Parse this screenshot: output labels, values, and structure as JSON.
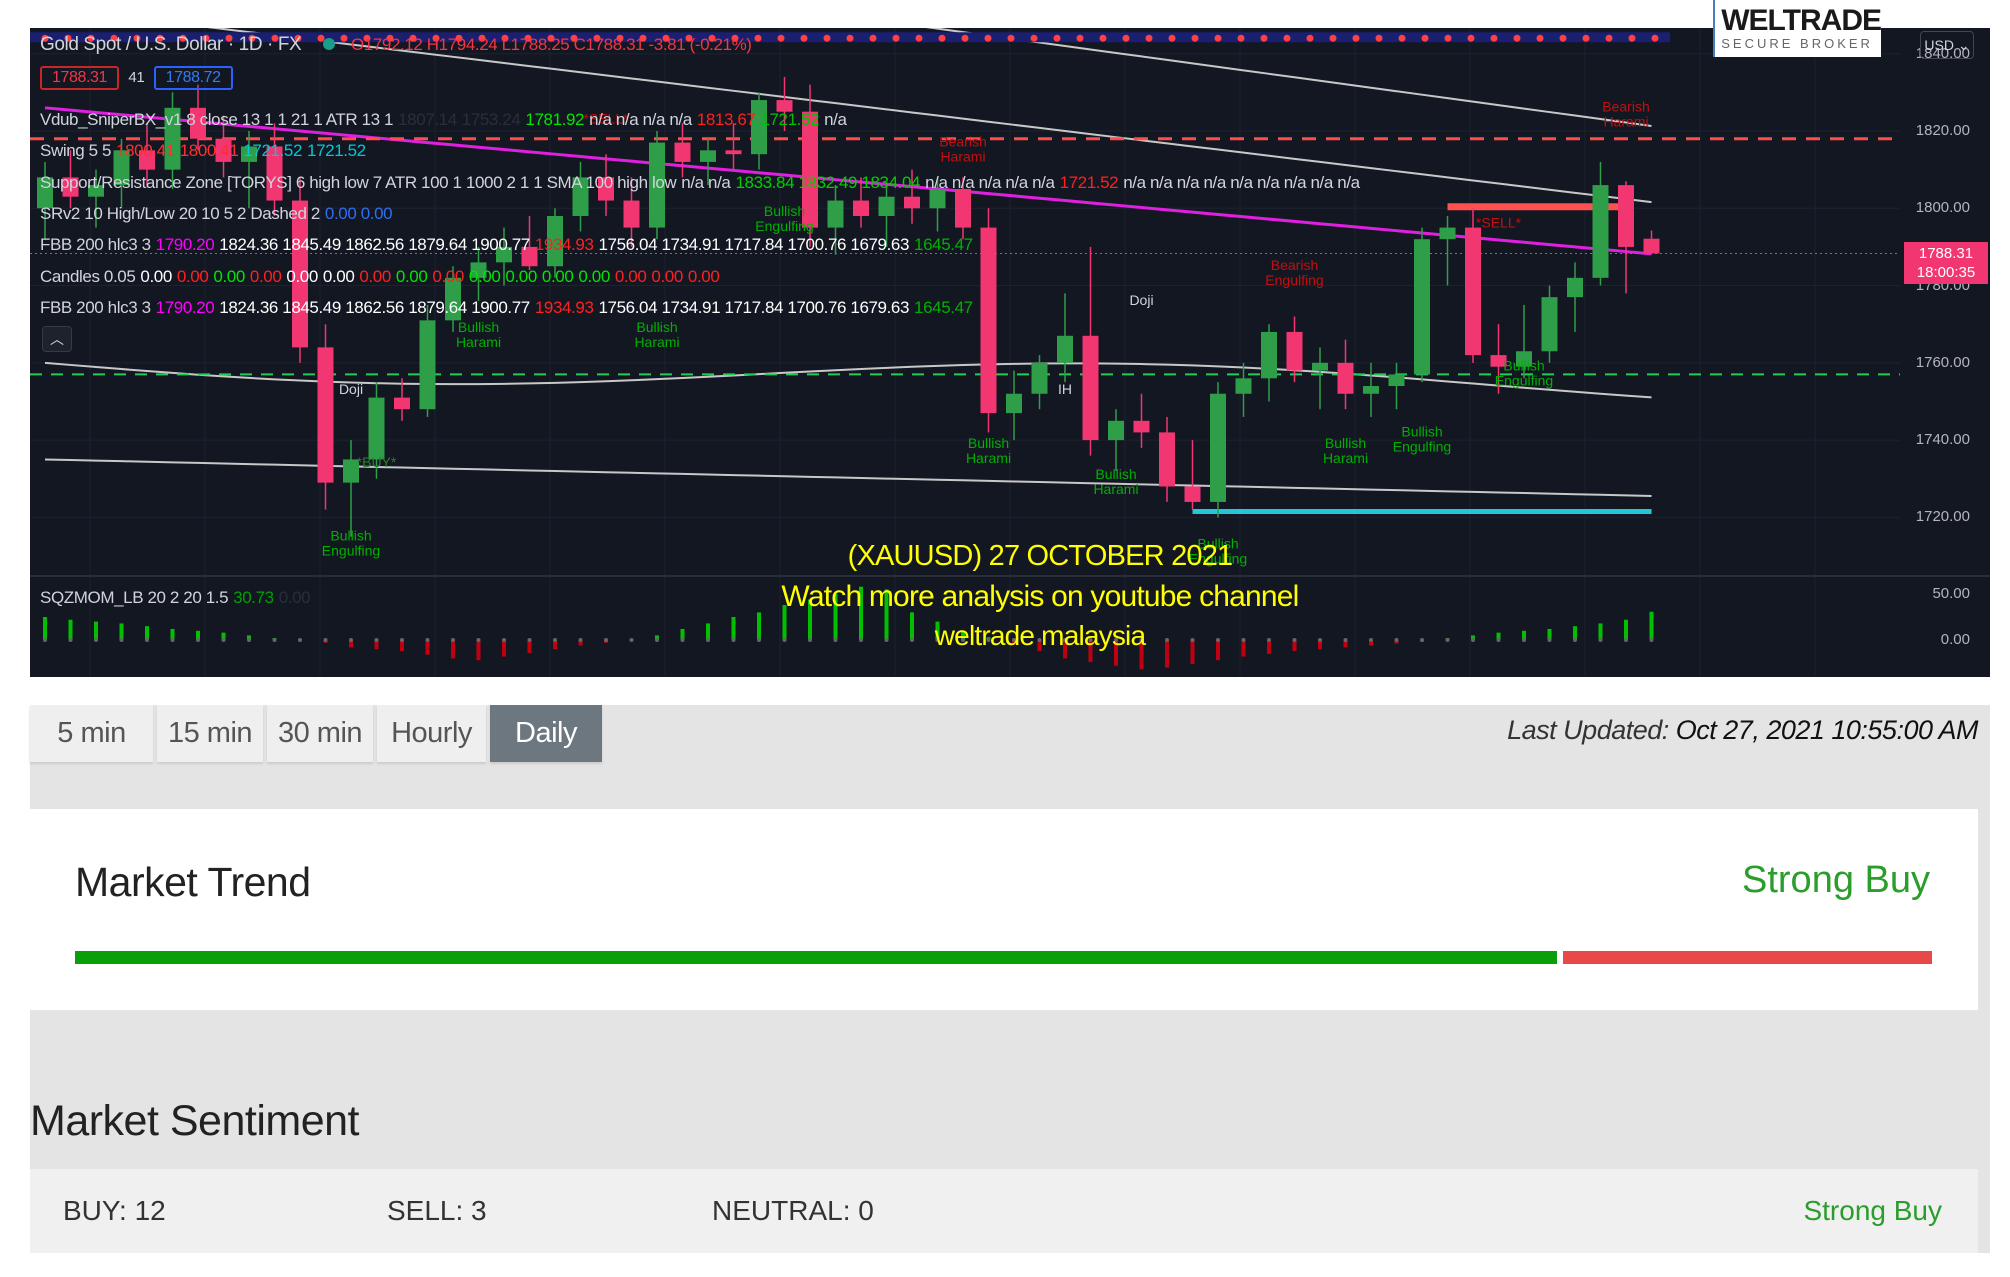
{
  "chart": {
    "symbol_line": "Gold Spot / U.S. Dollar · 1D · FX",
    "ohlc": "O1792.12 H1794.24 L1788.25 C1788.31 -3.81 (-0.21%)",
    "bid": "1788.31",
    "spread": "41",
    "ask": "1788.72",
    "currency": "USD",
    "last_price": "1788.31",
    "countdown": "18:00:35",
    "price_axis": [
      "1840.00",
      "1820.00",
      "1800.00",
      "1780.00",
      "1760.00",
      "1740.00",
      "1720.00"
    ],
    "momentum_axis": [
      "50.00",
      "0.00"
    ],
    "indicators": [
      [
        {
          "t": "Vdub_SniperBX_v1 8 close 13 1 1 21 1 ATR 13 1",
          "c": "#d1d4dc"
        },
        {
          "t": "1807.14",
          "c": "#2a2e39"
        },
        {
          "t": "1753.24",
          "c": "#2a2e39"
        },
        {
          "t": "1781.92",
          "c": "#00e600"
        },
        {
          "t": "n/a n/a n/a n/a",
          "c": "#d1d4dc"
        },
        {
          "t": "1813.67",
          "c": "#ff2020"
        },
        {
          "t": "1721.52",
          "c": "#00c000"
        },
        {
          "t": "n/a",
          "c": "#d1d4dc"
        }
      ],
      [
        {
          "t": "Swing 5 5",
          "c": "#d1d4dc"
        },
        {
          "t": "1800.41",
          "c": "#ff3030"
        },
        {
          "t": "1800.41",
          "c": "#ff3030"
        },
        {
          "t": "1721.52",
          "c": "#00c8d8"
        },
        {
          "t": "1721.52",
          "c": "#00c8d8"
        }
      ],
      [
        {
          "t": "Support/Resistance Zone [TORYS] 6 high low 7 ATR 100 1 1000 2 1 1 SMA 100 high low",
          "c": "#d1d4dc"
        },
        {
          "t": "n/a n/a",
          "c": "#d1d4dc"
        },
        {
          "t": "1833.84 1832.49 1834.04",
          "c": "#00d000"
        },
        {
          "t": "n/a n/a n/a n/a n/a",
          "c": "#d1d4dc"
        },
        {
          "t": "1721.52",
          "c": "#ff2020"
        },
        {
          "t": "n/a n/a n/a n/a n/a n/a n/a n/a n/a",
          "c": "#d1d4dc"
        }
      ],
      [
        {
          "t": "SRv2 10 High/Low 20 10 5 2 Dashed 2",
          "c": "#d1d4dc"
        },
        {
          "t": "0.00 0.00",
          "c": "#2f6ff0"
        }
      ],
      [
        {
          "t": "FBB 200 hlc3 3",
          "c": "#d1d4dc"
        },
        {
          "t": "1790.20",
          "c": "#ff00ff"
        },
        {
          "t": "1824.36 1845.49 1862.56 1879.64 1900.77",
          "c": "#ffffff"
        },
        {
          "t": "1934.93",
          "c": "#ff2020"
        },
        {
          "t": "1756.04 1734.91 1717.84 1700.76 1679.63",
          "c": "#ffffff"
        },
        {
          "t": "1645.47",
          "c": "#00b000"
        }
      ],
      [
        {
          "t": "Candles 0.05",
          "c": "#d1d4dc"
        },
        {
          "t": "0.00",
          "c": "#ffffff"
        },
        {
          "t": "0.00",
          "c": "#ff2020"
        },
        {
          "t": "0.00",
          "c": "#00e600"
        },
        {
          "t": "0.00",
          "c": "#ff2020"
        },
        {
          "t": "0.00",
          "c": "#ffffff"
        },
        {
          "t": "0.00",
          "c": "#ffffff"
        },
        {
          "t": "0.00",
          "c": "#ff2020"
        },
        {
          "t": "0.00",
          "c": "#00e600"
        },
        {
          "t": "0.00",
          "c": "#ff2020"
        },
        {
          "t": "0.00",
          "c": "#00e600"
        },
        {
          "t": "0.00",
          "c": "#00e600"
        },
        {
          "t": "0.00",
          "c": "#00e600"
        },
        {
          "t": "0.00",
          "c": "#00e600"
        },
        {
          "t": "0.00",
          "c": "#ff2020"
        },
        {
          "t": "0.00",
          "c": "#ff2020"
        },
        {
          "t": "0.00",
          "c": "#ff2020"
        }
      ],
      [
        {
          "t": "FBB 200 hlc3 3",
          "c": "#d1d4dc"
        },
        {
          "t": "1790.20",
          "c": "#ff00ff"
        },
        {
          "t": "1824.36 1845.49 1862.56 1879.64 1900.77",
          "c": "#ffffff"
        },
        {
          "t": "1934.93",
          "c": "#ff2020"
        },
        {
          "t": "1756.04 1734.91 1717.84 1700.76 1679.63",
          "c": "#ffffff"
        },
        {
          "t": "1645.47",
          "c": "#00b000"
        }
      ]
    ],
    "momentum_legend": [
      {
        "t": "SQZMOM_LB 20 2 20 1.5",
        "c": "#d1d4dc"
      },
      {
        "t": "30.73",
        "c": "#00a000"
      },
      {
        "t": "0.00",
        "c": "#2a2e39"
      }
    ],
    "overlay_title": "(XAUUSD) 27 OCTOBER 2021",
    "overlay_line1": "Watch more analysis on youtube channel",
    "overlay_line2": "weltrade malaysia",
    "logo_brand": "WELTRADE",
    "logo_tagline": "SECURE BROKER",
    "colors": {
      "up": "#2e9e48",
      "down": "#f23672",
      "background": "#131722",
      "sma": "#e020e0",
      "overlay_text": "#ffff00"
    },
    "levels": {
      "resistance_dashed": 1818,
      "support_dashed": 1757,
      "support_zone": 1721.52,
      "resistance_zone": 1800.41
    },
    "candles": [
      [
        1800,
        1812,
        1792,
        1808
      ],
      [
        1808,
        1815,
        1800,
        1803
      ],
      [
        1803,
        1810,
        1795,
        1806
      ],
      [
        1806,
        1818,
        1800,
        1815
      ],
      [
        1815,
        1822,
        1806,
        1810
      ],
      [
        1810,
        1830,
        1805,
        1826
      ],
      [
        1826,
        1832,
        1815,
        1818
      ],
      [
        1818,
        1824,
        1808,
        1812
      ],
      [
        1812,
        1820,
        1800,
        1816
      ],
      [
        1816,
        1822,
        1798,
        1802
      ],
      [
        1802,
        1808,
        1760,
        1764
      ],
      [
        1764,
        1770,
        1722,
        1729
      ],
      [
        1729,
        1740,
        1715,
        1735
      ],
      [
        1735,
        1755,
        1730,
        1751
      ],
      [
        1751,
        1756,
        1745,
        1748
      ],
      [
        1748,
        1775,
        1746,
        1771
      ],
      [
        1771,
        1785,
        1768,
        1782
      ],
      [
        1782,
        1790,
        1776,
        1786
      ],
      [
        1786,
        1795,
        1780,
        1790
      ],
      [
        1790,
        1798,
        1784,
        1785
      ],
      [
        1785,
        1800,
        1782,
        1798
      ],
      [
        1798,
        1812,
        1794,
        1808
      ],
      [
        1808,
        1814,
        1798,
        1802
      ],
      [
        1802,
        1808,
        1790,
        1795
      ],
      [
        1795,
        1820,
        1792,
        1817
      ],
      [
        1817,
        1822,
        1808,
        1812
      ],
      [
        1812,
        1818,
        1806,
        1815
      ],
      [
        1815,
        1822,
        1810,
        1814
      ],
      [
        1814,
        1830,
        1810,
        1828
      ],
      [
        1828,
        1834,
        1820,
        1825
      ],
      [
        1825,
        1832,
        1790,
        1795
      ],
      [
        1795,
        1806,
        1788,
        1802
      ],
      [
        1802,
        1808,
        1795,
        1798
      ],
      [
        1798,
        1806,
        1790,
        1803
      ],
      [
        1803,
        1810,
        1796,
        1800
      ],
      [
        1800,
        1808,
        1794,
        1805
      ],
      [
        1805,
        1808,
        1792,
        1795
      ],
      [
        1795,
        1800,
        1742,
        1747
      ],
      [
        1747,
        1758,
        1740,
        1752
      ],
      [
        1752,
        1762,
        1748,
        1760
      ],
      [
        1760,
        1778,
        1755,
        1767
      ],
      [
        1767,
        1790,
        1736,
        1740
      ],
      [
        1740,
        1748,
        1732,
        1745
      ],
      [
        1745,
        1752,
        1738,
        1742
      ],
      [
        1742,
        1746,
        1724,
        1728
      ],
      [
        1728,
        1740,
        1722,
        1724
      ],
      [
        1724,
        1755,
        1720,
        1752
      ],
      [
        1752,
        1760,
        1746,
        1756
      ],
      [
        1756,
        1770,
        1750,
        1768
      ],
      [
        1768,
        1772,
        1755,
        1758
      ],
      [
        1758,
        1764,
        1748,
        1760
      ],
      [
        1760,
        1766,
        1748,
        1752
      ],
      [
        1752,
        1760,
        1746,
        1754
      ],
      [
        1754,
        1760,
        1748,
        1757
      ],
      [
        1757,
        1795,
        1755,
        1792
      ],
      [
        1792,
        1798,
        1780,
        1795
      ],
      [
        1795,
        1800,
        1760,
        1762
      ],
      [
        1762,
        1770,
        1752,
        1759
      ],
      [
        1759,
        1775,
        1756,
        1763
      ],
      [
        1763,
        1780,
        1760,
        1777
      ],
      [
        1777,
        1786,
        1768,
        1782
      ],
      [
        1782,
        1812,
        1780,
        1806
      ],
      [
        1806,
        1807,
        1778,
        1790
      ],
      [
        1792.12,
        1794.24,
        1788.25,
        1788.31
      ]
    ],
    "momentum": [
      25,
      22,
      20,
      18,
      15,
      12,
      10,
      8,
      5,
      2,
      1,
      -3,
      -8,
      -10,
      -12,
      -16,
      -20,
      -22,
      -18,
      -14,
      -10,
      -6,
      -3,
      1,
      5,
      12,
      18,
      25,
      30,
      38,
      44,
      50,
      58,
      55,
      30,
      20,
      10,
      3,
      -5,
      -12,
      -20,
      -24,
      -28,
      -32,
      -30,
      -26,
      -22,
      -18,
      -15,
      -12,
      -10,
      -8,
      -6,
      -4,
      -2,
      2,
      5,
      8,
      10,
      12,
      15,
      18,
      22,
      30.73
    ],
    "annotations": [
      {
        "text": "Doji",
        "i": 12,
        "p": 1752,
        "c": "#d1d4dc"
      },
      {
        "text": "Bullish Engulfing",
        "i": 12,
        "p": 1714,
        "c": "#00b000"
      },
      {
        "text": "*BUY*",
        "i": 13,
        "p": 1733,
        "c": "#2e7d32"
      },
      {
        "text": "Bullish Harami",
        "i": 17,
        "p": 1768,
        "c": "#00b000"
      },
      {
        "text": "Bullish Harami",
        "i": 24,
        "p": 1768,
        "c": "#00b000"
      },
      {
        "text": "*SELL*",
        "i": 22,
        "p": 1822,
        "c": "#c01010"
      },
      {
        "text": "Bullish Engulfing",
        "i": 29,
        "p": 1798,
        "c": "#00b000"
      },
      {
        "text": "Bearish Harami",
        "i": 36,
        "p": 1816,
        "c": "#c01010"
      },
      {
        "text": "Bullish Harami",
        "i": 37,
        "p": 1738,
        "c": "#00b000"
      },
      {
        "text": "IH",
        "i": 40,
        "p": 1752,
        "c": "#d1d4dc"
      },
      {
        "text": "Doji",
        "i": 43,
        "p": 1775,
        "c": "#d1d4dc"
      },
      {
        "text": "Bullish Harami",
        "i": 42,
        "p": 1730,
        "c": "#00b000"
      },
      {
        "text": "Bullish Engulfing",
        "i": 46,
        "p": 1712,
        "c": "#00b000"
      },
      {
        "text": "Bearish Engulfing",
        "i": 49,
        "p": 1784,
        "c": "#c01010"
      },
      {
        "text": "Bullish Harami",
        "i": 51,
        "p": 1738,
        "c": "#00b000"
      },
      {
        "text": "Bullish Engulfing",
        "i": 54,
        "p": 1741,
        "c": "#00b000"
      },
      {
        "text": "*SELL*",
        "i": 57,
        "p": 1795,
        "c": "#c01010"
      },
      {
        "text": "Bullish Engulfing",
        "i": 58,
        "p": 1758,
        "c": "#00b000"
      },
      {
        "text": "Bearish Harami",
        "i": 62,
        "p": 1825,
        "c": "#c01010"
      }
    ]
  },
  "timeframes": {
    "tabs": [
      "5 min",
      "15 min",
      "30 min",
      "Hourly",
      "Daily"
    ],
    "active": "Daily"
  },
  "last_updated": {
    "label": "Last Updated:",
    "value": "Oct 27, 2021 10:55:00 AM"
  },
  "market_trend": {
    "title": "Market Trend",
    "signal": "Strong Buy",
    "buy_fraction": 0.8,
    "buy_color": "#0a9e0a",
    "sell_color": "#e84848"
  },
  "market_sentiment": {
    "title": "Market Sentiment",
    "buy": "BUY: 12",
    "sell": "SELL: 3",
    "neutral": "NEUTRAL: 0",
    "signal": "Strong Buy"
  }
}
